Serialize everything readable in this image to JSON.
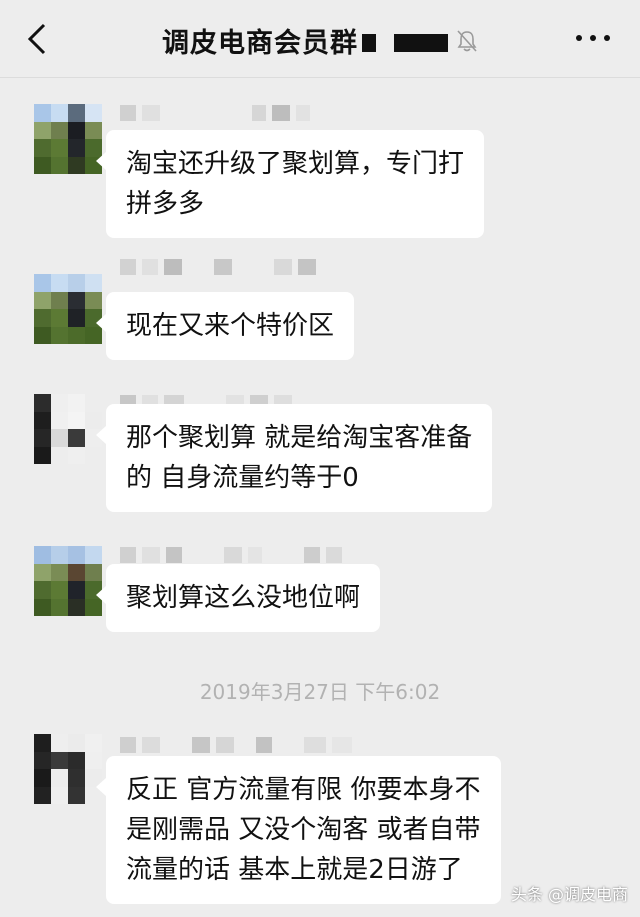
{
  "header": {
    "title": "调皮电商会员群",
    "back_icon": "chevron-left-icon",
    "mute_icon": "bell-off-icon",
    "more_icon": "more-dots-icon"
  },
  "messages": [
    {
      "text_lines": [
        "淘宝还升级了聚划算，专门打",
        "拼多多"
      ]
    },
    {
      "text_lines": [
        "现在又来个特价区"
      ]
    },
    {
      "text_lines": [
        "那个聚划算 就是给淘宝客准备",
        "的 自身流量约等于0"
      ]
    },
    {
      "text_lines": [
        "聚划算这么没地位啊"
      ]
    },
    {
      "text_lines": [
        "反正 官方流量有限 你要本身不",
        "是刚需品 又没个淘客 或者自带",
        "流量的话 基本上就是2日游了"
      ]
    }
  ],
  "timestamp": "2019年3月27日 下午6:02",
  "watermark": "头条 @调皮电商",
  "colors": {
    "background": "#ededed",
    "bubble": "#ffffff",
    "text": "#111111",
    "timestamp": "#b2b2b2"
  }
}
